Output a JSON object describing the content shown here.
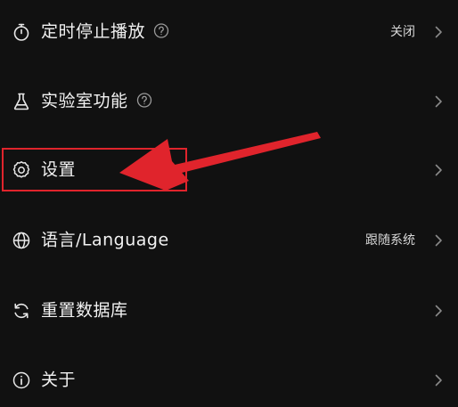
{
  "menu": {
    "items": [
      {
        "id": "sleep-timer",
        "label": "定时停止播放",
        "value": "关闭",
        "has_help": true,
        "icon": "timer-icon"
      },
      {
        "id": "lab-features",
        "label": "实验室功能",
        "value": "",
        "has_help": true,
        "icon": "flask-icon"
      },
      {
        "id": "settings",
        "label": "设置",
        "value": "",
        "has_help": false,
        "icon": "gear-icon"
      },
      {
        "id": "language",
        "label": "语言/Language",
        "value": "跟随系统",
        "has_help": false,
        "icon": "globe-icon"
      },
      {
        "id": "reset-database",
        "label": "重置数据库",
        "value": "",
        "has_help": false,
        "icon": "refresh-icon"
      },
      {
        "id": "about",
        "label": "关于",
        "value": "",
        "has_help": false,
        "icon": "info-icon"
      }
    ]
  },
  "annotation": {
    "target": "settings",
    "color": "#e0242c"
  },
  "colors": {
    "background": "#111111",
    "text": "#f2f2f2",
    "secondary_text": "#d8d8d8",
    "chevron": "#8a8a8a",
    "annotation_red": "#e0242c"
  }
}
